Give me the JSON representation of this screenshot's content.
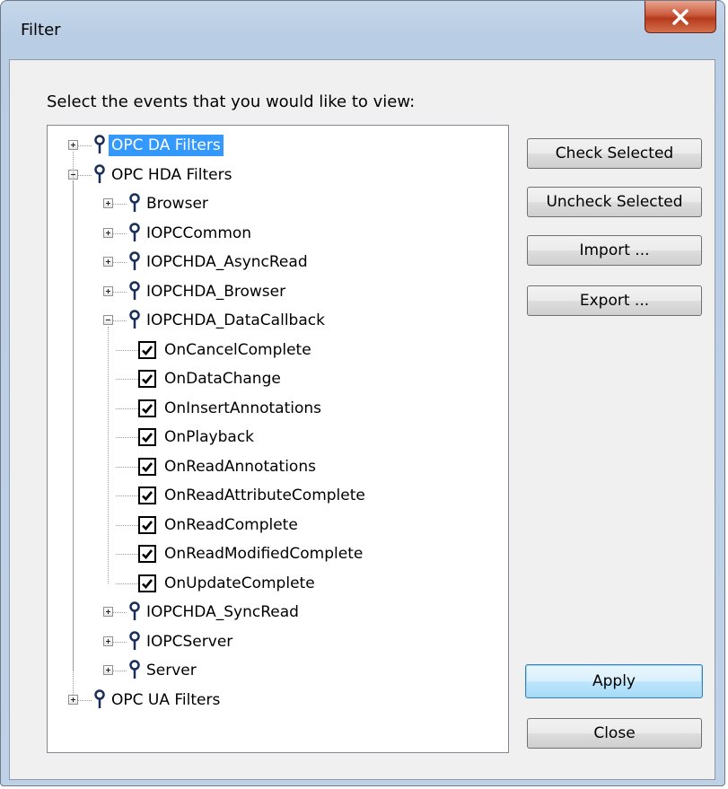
{
  "window": {
    "title": "Filter"
  },
  "prompt": "Select the events that you would like to view:",
  "tree": {
    "roots": [
      {
        "label": "OPC DA Filters",
        "expanded": false,
        "selected": true
      },
      {
        "label": "OPC HDA Filters",
        "expanded": true,
        "children": [
          {
            "label": "Browser",
            "expanded": false
          },
          {
            "label": "IOPCCommon",
            "expanded": false
          },
          {
            "label": "IOPCHDA_AsyncRead",
            "expanded": false
          },
          {
            "label": "IOPCHDA_Browser",
            "expanded": false
          },
          {
            "label": "IOPCHDA_DataCallback",
            "expanded": true,
            "children": [
              {
                "label": "OnCancelComplete",
                "checked": true
              },
              {
                "label": "OnDataChange",
                "checked": true
              },
              {
                "label": "OnInsertAnnotations",
                "checked": true
              },
              {
                "label": "OnPlayback",
                "checked": true
              },
              {
                "label": "OnReadAnnotations",
                "checked": true
              },
              {
                "label": "OnReadAttributeComplete",
                "checked": true
              },
              {
                "label": "OnReadComplete",
                "checked": true
              },
              {
                "label": "OnReadModifiedComplete",
                "checked": true
              },
              {
                "label": "OnUpdateComplete",
                "checked": true
              }
            ]
          },
          {
            "label": "IOPCHDA_SyncRead",
            "expanded": false
          },
          {
            "label": "IOPCServer",
            "expanded": false
          },
          {
            "label": "Server",
            "expanded": false
          }
        ]
      },
      {
        "label": "OPC UA Filters",
        "expanded": false
      }
    ]
  },
  "buttons": {
    "check_selected": "Check Selected",
    "uncheck_selected": "Uncheck Selected",
    "import": "Import ...",
    "export": "Export ...",
    "apply": "Apply",
    "close": "Close"
  },
  "icons": {
    "node": "pin-icon",
    "close": "close-icon"
  },
  "colors": {
    "selection": "#3399ff",
    "close_button": "#c75a3a"
  }
}
